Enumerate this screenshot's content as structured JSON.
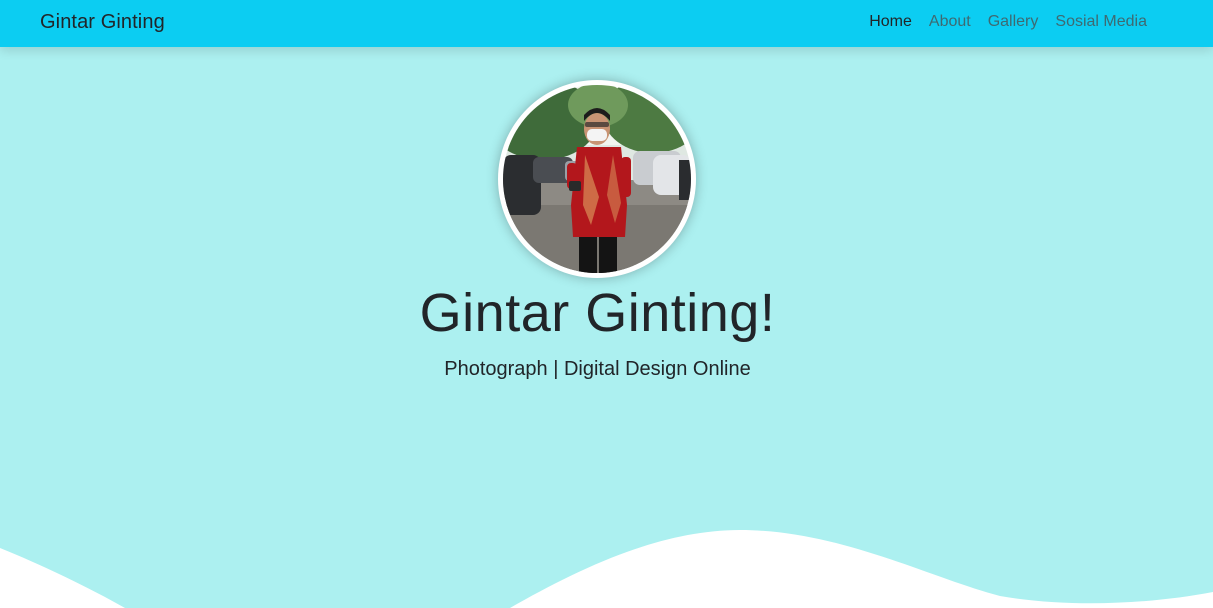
{
  "navbar": {
    "brand": "Gintar Ginting",
    "links": [
      {
        "label": "Home",
        "active": true
      },
      {
        "label": "About",
        "active": false
      },
      {
        "label": "Gallery",
        "active": false
      },
      {
        "label": "Sosial Media",
        "active": false
      }
    ]
  },
  "hero": {
    "title": "Gintar Ginting!",
    "subtitle": "Photograph | Digital Design Online",
    "avatar_icon": "profile-photo"
  },
  "colors": {
    "navbar_bg": "#0ccdf2",
    "hero_bg": "#acf0f0",
    "wave": "#ffffff",
    "text": "#212529"
  }
}
